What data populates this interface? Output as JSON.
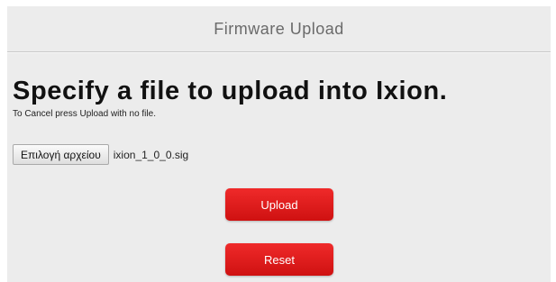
{
  "header": {
    "title": "Firmware Upload"
  },
  "main": {
    "heading": "Specify a file to upload into Ixion.",
    "note": "To Cancel press Upload with no file.",
    "file_picker": {
      "button_label": "Επιλογή αρχείου",
      "selected_file": "ixion_1_0_0.sig"
    },
    "upload_label": "Upload",
    "reset_label": "Reset"
  },
  "colors": {
    "panel_bg": "#ececec",
    "button_red": "#e01a1a",
    "header_text": "#6a6a6a"
  }
}
